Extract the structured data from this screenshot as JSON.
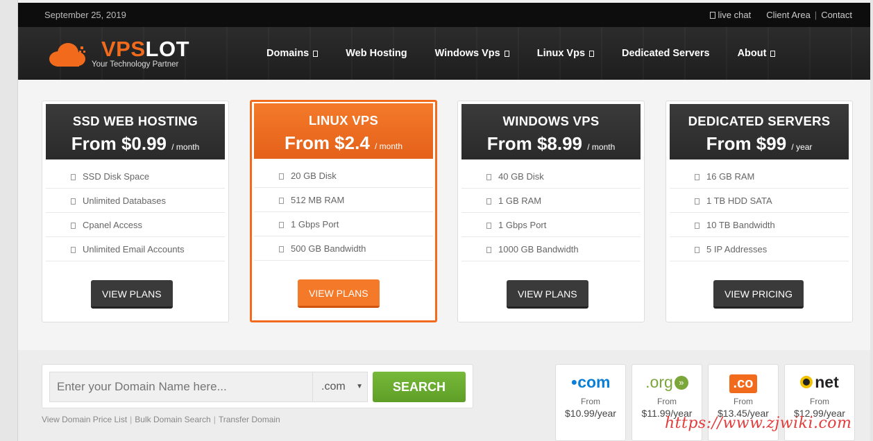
{
  "topbar": {
    "date": "September 25, 2019",
    "live_chat": "live chat",
    "client_area": "Client Area",
    "separator": "|",
    "contact": "Contact"
  },
  "brand": {
    "name_part1": "VPS",
    "name_part2": "LOT",
    "tagline": "Your Technology Partner",
    "accent_color": "#f26b1d"
  },
  "nav": {
    "items": [
      {
        "label": "Domains",
        "has_dropdown": true
      },
      {
        "label": "Web Hosting",
        "has_dropdown": false
      },
      {
        "label": "Windows Vps",
        "has_dropdown": true
      },
      {
        "label": "Linux Vps",
        "has_dropdown": true
      },
      {
        "label": "Dedicated Servers",
        "has_dropdown": false
      },
      {
        "label": "About",
        "has_dropdown": true
      }
    ]
  },
  "plans": [
    {
      "title": "SSD WEB HOSTING",
      "price": "From $0.99",
      "period": "/ month",
      "features": [
        "SSD Disk Space",
        "Unlimited Databases",
        "Cpanel Access",
        "Unlimited Email Accounts"
      ],
      "button": "VIEW PLANS"
    },
    {
      "title": "LINUX VPS",
      "price": "From $2.4",
      "period": "/ month",
      "features": [
        "20 GB Disk",
        "512 MB RAM",
        "1 Gbps Port",
        "500 GB Bandwidth"
      ],
      "button": "VIEW PLANS"
    },
    {
      "title": "WINDOWS VPS",
      "price": "From $8.99",
      "period": "/ month",
      "features": [
        "40 GB Disk",
        "1 GB RAM",
        "1 Gbps Port",
        "1000 GB Bandwidth"
      ],
      "button": "VIEW PLANS"
    },
    {
      "title": "DEDICATED SERVERS",
      "price": "From $99",
      "period": "/ year",
      "features": [
        "16 GB RAM",
        "1 TB HDD SATA",
        "10 TB Bandwidth",
        "5 IP Addresses"
      ],
      "button": "VIEW PRICING"
    }
  ],
  "domain_search": {
    "placeholder": "Enter your Domain Name here...",
    "tld_selected": ".com",
    "search_label": "SEARCH",
    "links": [
      "View Domain Price List",
      "Bulk Domain Search",
      "Transfer Domain"
    ],
    "separator": "|"
  },
  "tlds": [
    {
      "name": "com",
      "from": "From",
      "price": "$10.99/year",
      "color": "#0b7fd6"
    },
    {
      "name": ".org",
      "from": "From",
      "price": "$11.99/year",
      "color": "#7aa63a"
    },
    {
      "name": ".co",
      "from": "From",
      "price": "$13.45/year",
      "color": "#f26b1d"
    },
    {
      "name": "net",
      "from": "From",
      "price": "$12.99/year",
      "color": "#222222"
    }
  ],
  "watermark": "https://www.zjwiki.com"
}
